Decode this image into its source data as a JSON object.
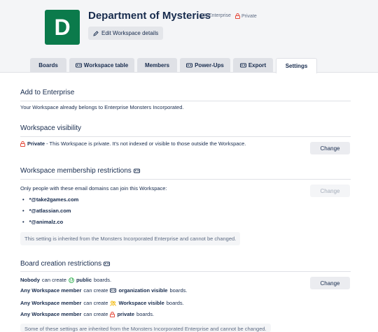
{
  "workspace": {
    "avatar_letter": "D",
    "title": "Department of Mysteries",
    "enterprise_label": "Enterprise",
    "private_label": "Private",
    "edit_label": "Edit Workspace details"
  },
  "tabs": [
    {
      "label": "Boards"
    },
    {
      "label": "Workspace table"
    },
    {
      "label": "Members"
    },
    {
      "label": "Power-Ups"
    },
    {
      "label": "Export"
    },
    {
      "label": "Settings",
      "active": true
    }
  ],
  "enterprise": {
    "title": "Add to Enterprise",
    "text": "Your Workspace already belongs to Enterprise Monsters Incorporated."
  },
  "visibility": {
    "title": "Workspace visibility",
    "status": "Private",
    "text": " - This Workspace is private. It's not indexed or visible to those outside the Workspace.",
    "button": "Change"
  },
  "membership": {
    "title": "Workspace membership restrictions",
    "text": "Only people with these email domains can join this Workspace:",
    "domains": [
      "*@take2games.com",
      "*@atlassian.com",
      "*@animalz.co"
    ],
    "note": "This setting is inherited from the Monsters Incorporated Enterprise and cannot be changed.",
    "button": "Change"
  },
  "board_creation": {
    "title": "Board creation restrictions",
    "button": "Change",
    "rules": [
      {
        "who": "Nobody",
        "mid": " can create ",
        "type": "public",
        "tail": " boards."
      },
      {
        "who": "Any Workspace member",
        "mid": " can create ",
        "type": "organization visible",
        "tail": " boards."
      },
      {
        "who": "Any Workspace member",
        "mid": " can create ",
        "type": "Workspace visible",
        "tail": " boards."
      },
      {
        "who": "Any Workspace member",
        "mid": " can create ",
        "type": "private",
        "tail": " boards."
      }
    ],
    "note": "Some of these settings are inherited from the Monsters Incorporated Enterprise and cannot be changed."
  },
  "colors": {
    "avatar": "#0b7a4b",
    "private_icon": "#e5493a",
    "public_icon": "#3fb55b",
    "workspace_icon": "#f2b600"
  }
}
